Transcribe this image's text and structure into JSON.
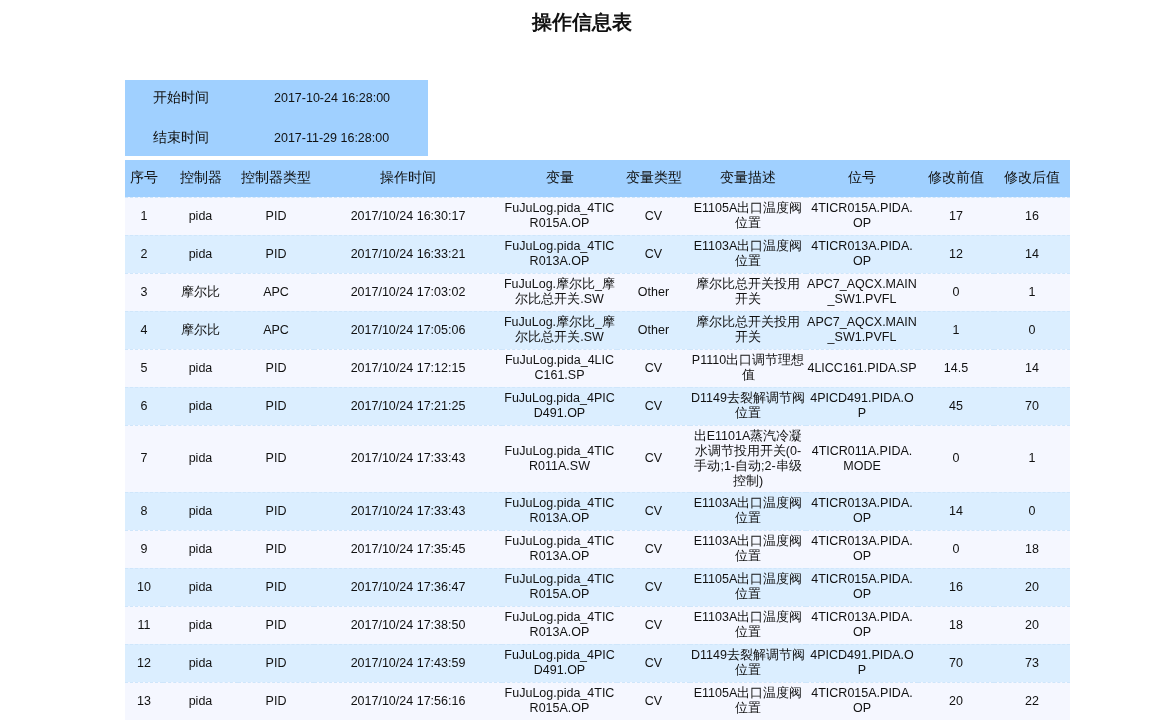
{
  "title": "操作信息表",
  "range": [
    {
      "label": "开始时间",
      "value": "2017-10-24 16:28:00"
    },
    {
      "label": "结束时间",
      "value": "2017-11-29 16:28:00"
    }
  ],
  "table": {
    "columns": [
      "序号",
      "控制器",
      "控制器类型",
      "操作时间",
      "变量",
      "变量类型",
      "变量描述",
      "位号",
      "修改前值",
      "修改后值"
    ],
    "rows": [
      [
        "1",
        "pida",
        "PID",
        "2017/10/24 16:30:17",
        "FuJuLog.pida_4TICR015A.OP",
        "CV",
        "E1105A出口温度阀位置",
        "4TICR015A.PIDA.OP",
        "17",
        "16"
      ],
      [
        "2",
        "pida",
        "PID",
        "2017/10/24 16:33:21",
        "FuJuLog.pida_4TICR013A.OP",
        "CV",
        "E1103A出口温度阀位置",
        "4TICR013A.PIDA.OP",
        "12",
        "14"
      ],
      [
        "3",
        "摩尔比",
        "APC",
        "2017/10/24 17:03:02",
        "FuJuLog.摩尔比_摩尔比总开关.SW",
        "Other",
        "摩尔比总开关投用开关",
        "APC7_AQCX.MAIN_SW1.PVFL",
        "0",
        "1"
      ],
      [
        "4",
        "摩尔比",
        "APC",
        "2017/10/24 17:05:06",
        "FuJuLog.摩尔比_摩尔比总开关.SW",
        "Other",
        "摩尔比总开关投用开关",
        "APC7_AQCX.MAIN_SW1.PVFL",
        "1",
        "0"
      ],
      [
        "5",
        "pida",
        "PID",
        "2017/10/24 17:12:15",
        "FuJuLog.pida_4LICC161.SP",
        "CV",
        "P1110出口调节理想值",
        "4LICC161.PIDA.SP",
        "14.5",
        "14"
      ],
      [
        "6",
        "pida",
        "PID",
        "2017/10/24 17:21:25",
        "FuJuLog.pida_4PICD491.OP",
        "CV",
        "D1149去裂解调节阀位置",
        "4PICD491.PIDA.OP",
        "45",
        "70"
      ],
      [
        "7",
        "pida",
        "PID",
        "2017/10/24 17:33:43",
        "FuJuLog.pida_4TICR011A.SW",
        "CV",
        "出E1101A蒸汽冷凝水调节投用开关(0-手动;1-自动;2-串级控制)",
        "4TICR011A.PIDA.MODE",
        "0",
        "1"
      ],
      [
        "8",
        "pida",
        "PID",
        "2017/10/24 17:33:43",
        "FuJuLog.pida_4TICR013A.OP",
        "CV",
        "E1103A出口温度阀位置",
        "4TICR013A.PIDA.OP",
        "14",
        "0"
      ],
      [
        "9",
        "pida",
        "PID",
        "2017/10/24 17:35:45",
        "FuJuLog.pida_4TICR013A.OP",
        "CV",
        "E1103A出口温度阀位置",
        "4TICR013A.PIDA.OP",
        "0",
        "18"
      ],
      [
        "10",
        "pida",
        "PID",
        "2017/10/24 17:36:47",
        "FuJuLog.pida_4TICR015A.OP",
        "CV",
        "E1105A出口温度阀位置",
        "4TICR015A.PIDA.OP",
        "16",
        "20"
      ],
      [
        "11",
        "pida",
        "PID",
        "2017/10/24 17:38:50",
        "FuJuLog.pida_4TICR013A.OP",
        "CV",
        "E1103A出口温度阀位置",
        "4TICR013A.PIDA.OP",
        "18",
        "20"
      ],
      [
        "12",
        "pida",
        "PID",
        "2017/10/24 17:43:59",
        "FuJuLog.pida_4PICD491.OP",
        "CV",
        "D1149去裂解调节阀位置",
        "4PICD491.PIDA.OP",
        "70",
        "73"
      ],
      [
        "13",
        "pida",
        "PID",
        "2017/10/24 17:56:16",
        "FuJuLog.pida_4TICR015A.OP",
        "CV",
        "E1105A出口温度阀位置",
        "4TICR015A.PIDA.OP",
        "20",
        "22"
      ]
    ]
  }
}
